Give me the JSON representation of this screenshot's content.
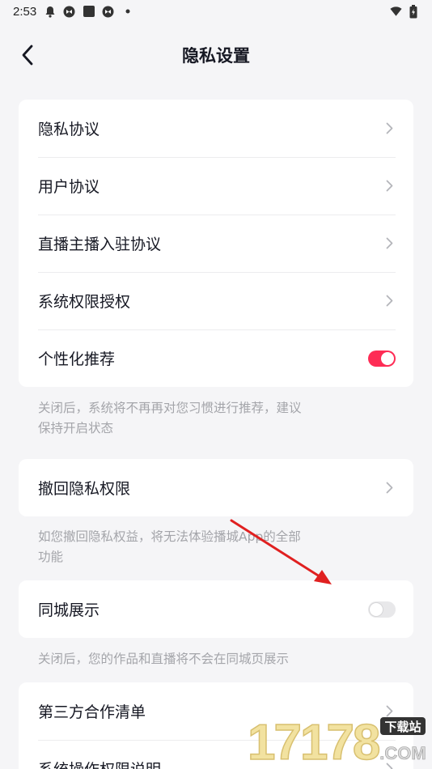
{
  "status_bar": {
    "time": "2:53",
    "icons": [
      "notification-bell-icon",
      "app-icon",
      "square-icon",
      "app-icon-2",
      "dot-icon"
    ],
    "right_icons": [
      "wifi-icon",
      "battery-icon"
    ]
  },
  "nav": {
    "title": "隐私设置",
    "back_icon": "chevron-left-icon"
  },
  "section1": {
    "items": [
      {
        "label": "隐私协议",
        "control": "chevron"
      },
      {
        "label": "用户协议",
        "control": "chevron"
      },
      {
        "label": "直播主播入驻协议",
        "control": "chevron"
      },
      {
        "label": "系统权限授权",
        "control": "chevron"
      },
      {
        "label": "个性化推荐",
        "control": "toggle",
        "toggle_on": true
      }
    ],
    "hint_line1": "关闭后，系统将不再再对您习惯进行推荐，建议",
    "hint_line2": "保持开启状态"
  },
  "section2": {
    "items": [
      {
        "label": "撤回隐私权限",
        "control": "chevron"
      }
    ],
    "hint_line1": "如您撤回隐私权益，将无法体验播城App的全部",
    "hint_line2": "功能"
  },
  "section3": {
    "items": [
      {
        "label": "同城展示",
        "control": "toggle",
        "toggle_on": false
      }
    ],
    "hint_line1": "关闭后，您的作品和直播将不会在同城页展示"
  },
  "section4": {
    "items": [
      {
        "label": "第三方合作清单",
        "control": "chevron"
      },
      {
        "label": "系统操作权限说明",
        "control": "chevron"
      }
    ]
  },
  "watermark": {
    "text": "17178",
    "badge": "下载站",
    "suffix": ".COM"
  },
  "colors": {
    "accent": "#fe2c55",
    "background": "#f5f5f7",
    "hint": "#a4a5aa",
    "annotation_arrow": "#e02020"
  }
}
